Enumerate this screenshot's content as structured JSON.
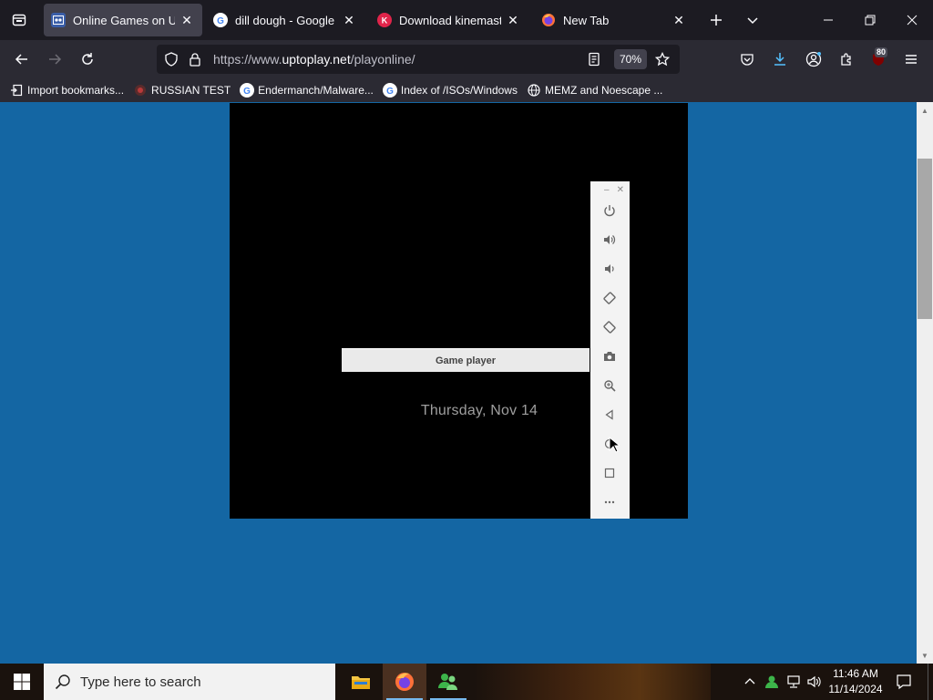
{
  "browser": {
    "tabs": [
      {
        "title": "Online Games on Uptoplay",
        "active": true,
        "favicon": "uptoplay-icon"
      },
      {
        "title": "dill dough - Google Search",
        "active": false,
        "favicon": "google-icon"
      },
      {
        "title": "Download kinemaster",
        "active": false,
        "favicon": "kinemaster-icon"
      },
      {
        "title": "New Tab",
        "active": false,
        "favicon": "firefox-icon"
      }
    ],
    "url_prefix": "https://www.",
    "url_host": "uptoplay.net",
    "url_path": "/playonline/",
    "zoom": "70%",
    "extension_badge": "80"
  },
  "bookmarks": [
    {
      "label": "Import bookmarks...",
      "icon": "import-icon"
    },
    {
      "label": "RUSSIAN TEST",
      "icon": "malware-icon"
    },
    {
      "label": "Endermanch/Malware...",
      "icon": "google-icon"
    },
    {
      "label": "Index of /ISOs/Windows",
      "icon": "google-icon"
    },
    {
      "label": "MEMZ and Noescape ...",
      "icon": "globe-icon"
    }
  ],
  "game": {
    "player_title": "Game player",
    "date_text": "Thursday, Nov 14"
  },
  "emulator_toolbar": {
    "buttons": [
      "power-icon",
      "volume-up-icon",
      "volume-down-icon",
      "rotate-left-icon",
      "rotate-right-icon",
      "camera-icon",
      "zoom-icon",
      "back-icon",
      "home-icon",
      "overview-icon",
      "more-icon"
    ]
  },
  "taskbar": {
    "search_placeholder": "Type here to search",
    "time": "11:46 AM",
    "date": "11/14/2024"
  },
  "colors": {
    "page_bg": "#1466a3",
    "browser_dark": "#1c1b22",
    "toolbar": "#2b2a33",
    "accent_blue": "#54ffbd"
  }
}
